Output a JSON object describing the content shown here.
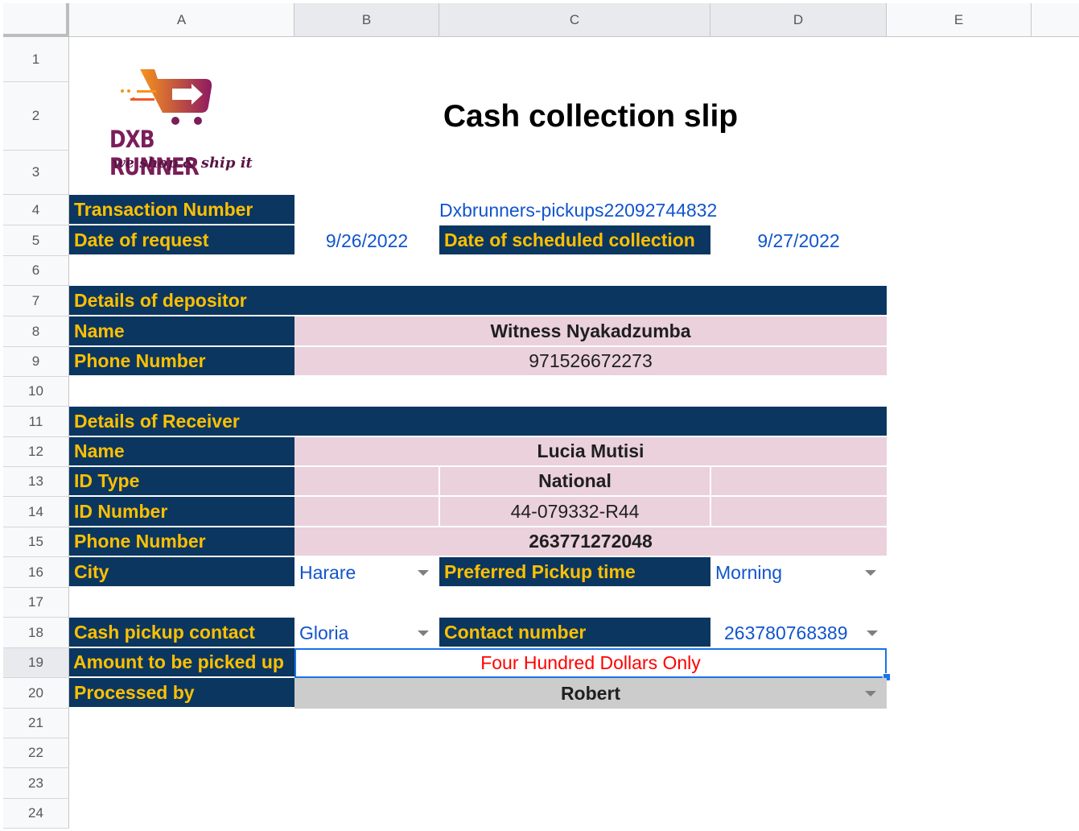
{
  "columns": [
    "A",
    "B",
    "C",
    "D",
    "E"
  ],
  "rows": [
    "1",
    "2",
    "3",
    "4",
    "5",
    "6",
    "7",
    "8",
    "9",
    "10",
    "11",
    "12",
    "13",
    "14",
    "15",
    "16",
    "17",
    "18",
    "19",
    "20",
    "21",
    "22",
    "23",
    "24"
  ],
  "logo": {
    "brand": "DXB RUNNER",
    "tagline": "we shop & ship it"
  },
  "title": "Cash collection slip",
  "transaction": {
    "label": "Transaction Number",
    "value": "Dxbrunners-pickups22092744832"
  },
  "request": {
    "label": "Date of request",
    "value": "9/26/2022"
  },
  "scheduled": {
    "label": "Date of scheduled collection",
    "value": "9/27/2022"
  },
  "depositor": {
    "header": "Details of depositor",
    "name_label": "Name",
    "name": "Witness Nyakadzumba",
    "phone_label": "Phone Number",
    "phone": "971526672273"
  },
  "receiver": {
    "header": "Details of Receiver",
    "name_label": "Name",
    "name": "Lucia Mutisi",
    "id_type_label": "ID Type",
    "id_type": "National",
    "id_number_label": "ID Number",
    "id_number": "44-079332-R44",
    "phone_label": "Phone Number",
    "phone": "263771272048",
    "city_label": "City",
    "city": "Harare",
    "pickup_time_label": "Preferred Pickup time",
    "pickup_time": "Morning"
  },
  "pickup": {
    "contact_label": "Cash pickup contact",
    "contact": "Gloria",
    "number_label": "Contact number",
    "number": "263780768389",
    "amount_label": "Amount to be picked up",
    "amount": "Four Hundred Dollars Only",
    "processed_label": "Processed by",
    "processed": "Robert"
  },
  "colors": {
    "label_bg": "#0b3660",
    "label_text": "#ffc000",
    "value_bg": "#ead1dc",
    "link_blue": "#1155cc",
    "amount_red": "#ff0000",
    "selection": "#1a73e8"
  }
}
